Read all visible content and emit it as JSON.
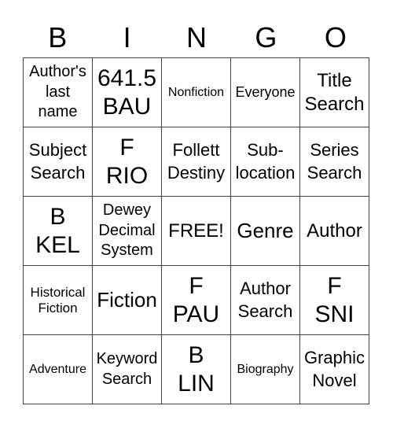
{
  "header": [
    "B",
    "I",
    "N",
    "G",
    "O"
  ],
  "grid": [
    [
      "Author's\nlast\nname",
      "641.5\nBAU",
      "Nonfiction",
      "Everyone",
      "Title\nSearch"
    ],
    [
      "Subject\nSearch",
      "F\nRIO",
      "Follett\nDestiny",
      "Sub-\nlocation",
      "Series\nSearch"
    ],
    [
      "B\nKEL",
      "Dewey\nDecimal\nSystem",
      "FREE!",
      "Genre",
      "Author"
    ],
    [
      "Historical\nFiction",
      "Fiction",
      "F\nPAU",
      "Author\nSearch",
      "F\nSNI"
    ],
    [
      "Adventure",
      "Keyword\nSearch",
      "B\nLIN",
      "Biography",
      "Graphic\nNovel"
    ]
  ]
}
